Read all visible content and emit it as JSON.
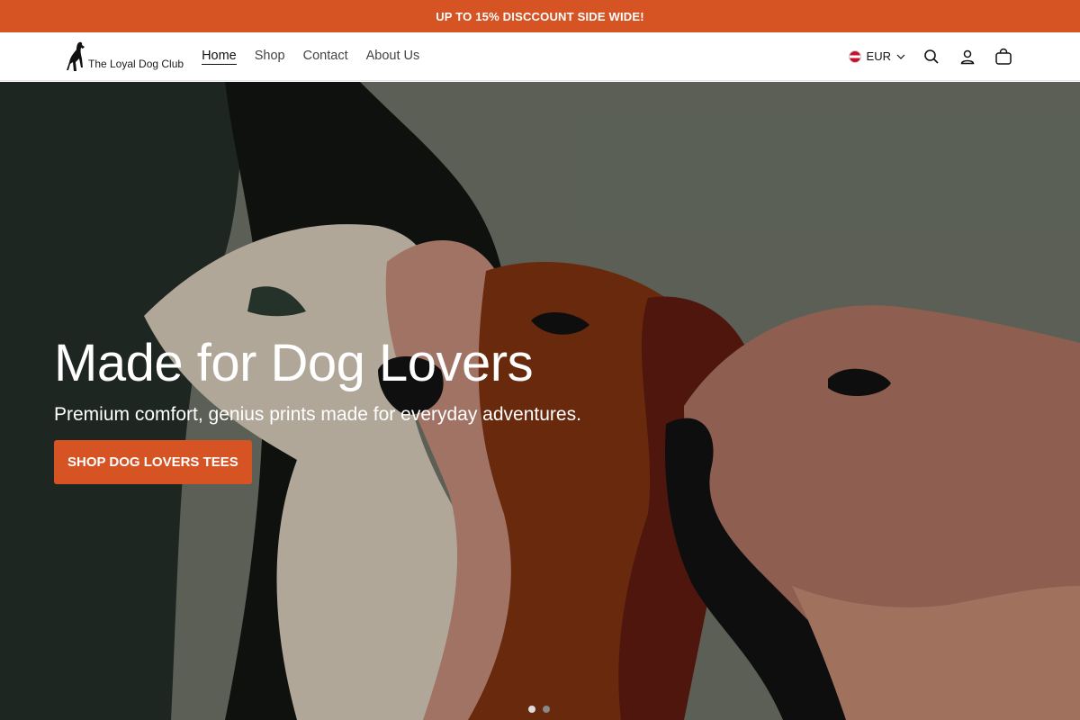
{
  "announcement": {
    "text": "UP TO 15% DISCCOUNT SIDE WIDE!"
  },
  "header": {
    "logo_text": "The Loyal Dog Club",
    "nav": [
      {
        "label": "Home",
        "active": true
      },
      {
        "label": "Shop"
      },
      {
        "label": "Contact"
      },
      {
        "label": "About Us"
      }
    ],
    "currency": "EUR",
    "icons": [
      "search-icon",
      "account-icon",
      "cart-icon"
    ]
  },
  "hero": {
    "title": "Made for Dog Lovers",
    "subtitle": "Premium comfort, genius prints made for everyday adventures.",
    "cta_label": "SHOP DOG LOVERS TEES",
    "slides_total": 2,
    "active_slide": 1
  },
  "colors": {
    "accent": "#d65424",
    "background": "#676e62"
  }
}
